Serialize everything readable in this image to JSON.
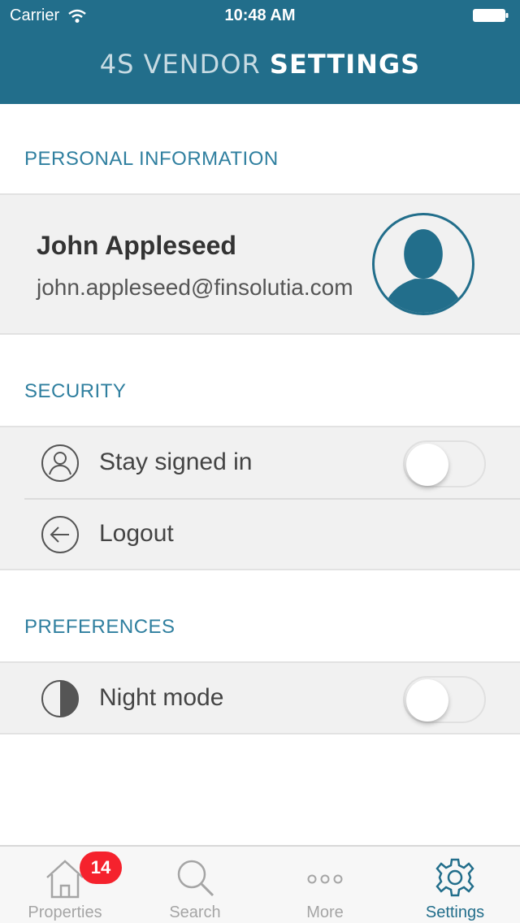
{
  "status_bar": {
    "carrier": "Carrier",
    "time": "10:48 AM"
  },
  "header": {
    "title_part1": "4S VENDOR",
    "title_part2": "SETTINGS",
    "background": "#226e8b"
  },
  "personal_information": {
    "section_title": "PERSONAL INFORMATION",
    "name": "John Appleseed",
    "email": "john.appleseed@finsolutia.com",
    "avatar_icon": "person-silhouette-icon"
  },
  "security": {
    "section_title": "SECURITY",
    "items": [
      {
        "label": "Stay signed in",
        "icon": "user-circle-icon",
        "toggle": false
      },
      {
        "label": "Logout",
        "icon": "arrow-left-circle-icon"
      }
    ]
  },
  "preferences": {
    "section_title": "PREFERENCES",
    "items": [
      {
        "label": "Night mode",
        "icon": "half-circle-icon",
        "toggle": false
      }
    ]
  },
  "tab_bar": {
    "tabs": [
      {
        "label": "Properties",
        "icon": "house-icon",
        "badge": "14"
      },
      {
        "label": "Search",
        "icon": "magnifier-icon"
      },
      {
        "label": "More",
        "icon": "dots-icon"
      },
      {
        "label": "Settings",
        "icon": "gear-icon",
        "active": true
      }
    ]
  },
  "colors": {
    "accent": "#226e8b",
    "badge": "#f5222d",
    "section_text": "#2f7f9f"
  }
}
